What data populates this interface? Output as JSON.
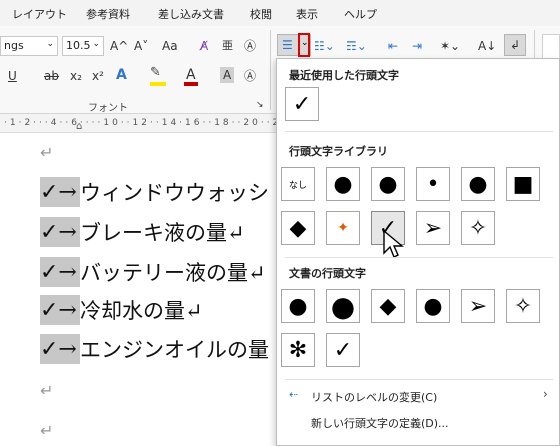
{
  "tabs": [
    "レイアウト",
    "参考資料",
    "差し込み文書",
    "校閲",
    "表示",
    "ヘルプ"
  ],
  "ribbon": {
    "font_name": "ngs",
    "font_size": "10.5",
    "grow_label": "A^",
    "shrink_label": "A˅",
    "case_label": "Aa",
    "underline_label": "U",
    "strike_label": "ab",
    "sub_label": "x₂",
    "sup_label": "x²",
    "effects_label": "A",
    "font_color_label": "A",
    "font_group_label": "フォント"
  },
  "document": {
    "lines": [
      {
        "bullet": "✓→",
        "text": "ウィンドウウォッシ"
      },
      {
        "bullet": "✓→",
        "text": "ブレーキ液の量↵"
      },
      {
        "bullet": "✓→",
        "text": "バッテリー液の量↵"
      },
      {
        "bullet": "✓→",
        "text": "冷却水の量↵"
      },
      {
        "bullet": "✓→",
        "text": "エンジンオイルの量"
      }
    ],
    "para_mark": "↵"
  },
  "panel": {
    "recent_title": "最近使用した行頭文字",
    "library_title": "行頭文字ライブラリ",
    "doc_title": "文書の行頭文字",
    "none_label": "なし",
    "recent": [
      "✓"
    ],
    "library": [
      "●",
      "●",
      "•",
      "●",
      "■",
      "◆",
      "✦",
      "✓",
      "➢",
      "✧"
    ],
    "doc_bullets": [
      "●",
      "●",
      "◆",
      "●",
      "➢",
      "✧",
      "✻",
      "✓"
    ],
    "change_level": "リストのレベルの変更(C)",
    "define_new": "新しい行頭文字の定義(D)..."
  },
  "colors": {
    "highlight": "#ffe600",
    "font_color": "#c00000",
    "accent_red_box": "#e00000",
    "selection_gray": "#c7c7c7"
  }
}
